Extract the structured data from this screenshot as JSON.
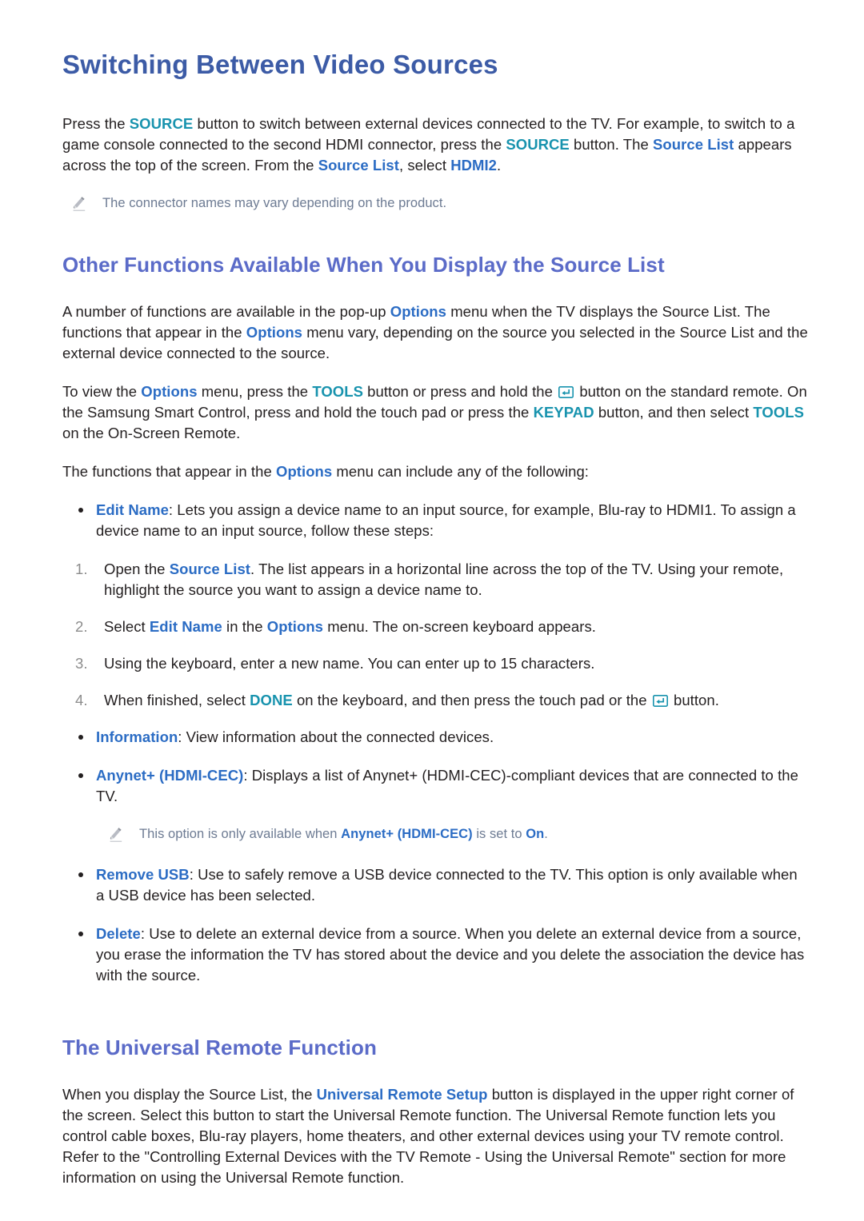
{
  "doc": {
    "title": "Switching Between Video Sources"
  },
  "intro": {
    "p1_a": "Press the ",
    "p1_kw1": "SOURCE",
    "p1_b": " button to switch between external devices connected to the TV. For example, to switch to a game console connected to the second HDMI connector, press the ",
    "p1_kw2": "SOURCE",
    "p1_c": " button. The ",
    "p1_kw3": "Source List",
    "p1_d": " appears across the top of the screen. From the ",
    "p1_kw4": "Source List",
    "p1_e": ", select ",
    "p1_kw5": "HDMI2",
    "p1_f": ".",
    "note1": "The connector names may vary depending on the product."
  },
  "section_other": {
    "heading": "Other Functions Available When You Display the Source List",
    "p1_a": "A number of functions are available in the pop-up ",
    "p1_kw1": "Options",
    "p1_b": " menu when the TV displays the Source List. The functions that appear in the ",
    "p1_kw2": "Options",
    "p1_c": " menu vary, depending on the source you selected in the Source List and the external device connected to the source.",
    "p2_a": "To view the ",
    "p2_kw1": "Options",
    "p2_b": " menu, press the ",
    "p2_kw2": "TOOLS",
    "p2_c": " button or press and hold the ",
    "p2_d": " button on the standard remote. On the Samsung Smart Control, press and hold the touch pad or press the ",
    "p2_kw3": "KEYPAD",
    "p2_e": " button, and then select ",
    "p2_kw4": "TOOLS",
    "p2_f": " on the On-Screen Remote.",
    "p3_a": "The functions that appear in the ",
    "p3_kw1": "Options",
    "p3_b": " menu can include any of the following:"
  },
  "edit_name_bullet": {
    "kw": "Edit Name",
    "text": ": Lets you assign a device name to an input source, for example, Blu-ray to HDMI1. To assign a device name to an input source, follow these steps:"
  },
  "steps": [
    {
      "num": "1.",
      "a": "Open the ",
      "kw": "Source List",
      "b": ". The list appears in a horizontal line across the top of the TV. Using your remote, highlight the source you want to assign a device name to."
    },
    {
      "num": "2.",
      "a": "Select ",
      "kw": "Edit Name",
      "b": " in the ",
      "kw2": "Options",
      "c": " menu. The on-screen keyboard appears."
    },
    {
      "num": "3.",
      "a": "Using the keyboard, enter a new name. You can enter up to 15 characters."
    },
    {
      "num": "4.",
      "a": "When finished, select ",
      "kw": "DONE",
      "b": " on the keyboard, and then press the touch pad or the ",
      "c": " button."
    }
  ],
  "bullets": {
    "information": {
      "kw": "Information",
      "text": ": View information about the connected devices."
    },
    "anynet": {
      "kw": "Anynet+ (HDMI-CEC)",
      "text": ": Displays a list of Anynet+ (HDMI-CEC)-compliant devices that are connected to the TV.",
      "note_a": "This option is only available when ",
      "note_kw": "Anynet+ (HDMI-CEC)",
      "note_b": " is set to ",
      "note_kw2": "On",
      "note_c": "."
    },
    "remove_usb": {
      "kw": "Remove USB",
      "text": ": Use to safely remove a USB device connected to the TV. This option is only available when a USB device has been selected."
    },
    "delete": {
      "kw": "Delete",
      "text": ": Use to delete an external device from a source. When you delete an external device from a source, you erase the information the TV has stored about the device and you delete the association the device has with the source."
    }
  },
  "section_universal": {
    "heading": "The Universal Remote Function",
    "p1_a": "When you display the Source List, the ",
    "p1_kw": "Universal Remote Setup",
    "p1_b": " button is displayed in the upper right corner of the screen. Select this button to start the Universal Remote function. The Universal Remote function lets you control cable boxes, Blu-ray players, home theaters, and other external devices using your TV remote control. Refer to the \"Controlling External Devices with the TV Remote - Using the Universal Remote\" section for more information on using the Universal Remote function."
  },
  "colors": {
    "title_blue": "#3c5ba6",
    "heading_blue": "#5b6bc8",
    "keyword_blue": "#2b6cc4",
    "keyword_teal": "#1893ae",
    "note_gray": "#6d7b93",
    "body_black": "#231f20"
  }
}
